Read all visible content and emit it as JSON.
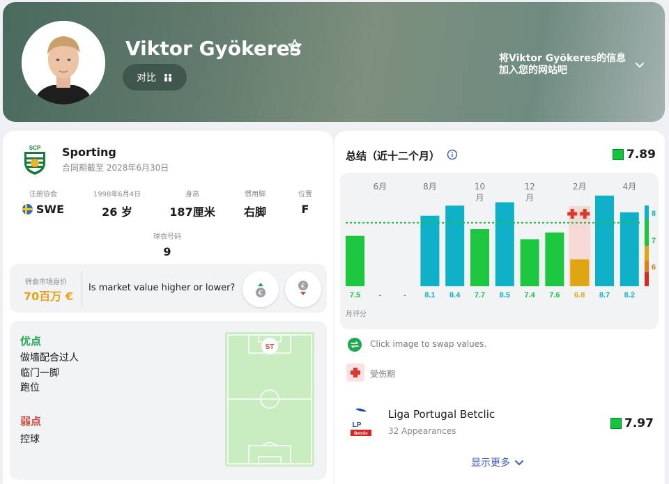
{
  "player": {
    "name": "Viktor Gyökeres",
    "compare_label": "对比",
    "embed_text": "将Viktor Gyökeres的信息加入您的网站吧"
  },
  "club": {
    "name": "Sporting",
    "logo_text": "SCP",
    "contract": "合同期截至 2028年6月30日"
  },
  "info": [
    {
      "label": "注册协会",
      "value": "SWE"
    },
    {
      "label": "1998年6月4日",
      "value": "26 岁"
    },
    {
      "label": "身高",
      "value": "187厘米"
    },
    {
      "label": "惯用脚",
      "value": "右脚"
    },
    {
      "label": "位置",
      "value": "F"
    }
  ],
  "shirt": {
    "label": "球衣号码",
    "value": "9"
  },
  "market_value": {
    "label": "转会市场身价",
    "value": "70百万 €",
    "question": "Is market value higher or lower?"
  },
  "traits": {
    "strengths_title": "优点",
    "strengths": [
      "做墙配合过人",
      "临门一脚",
      "跑位"
    ],
    "weaknesses_title": "弱点",
    "weaknesses": [
      "控球"
    ],
    "position_badge": "ST"
  },
  "summary": {
    "title": "总结（近十二个月）",
    "rating": "7.89"
  },
  "chart_data": {
    "type": "bar",
    "title": "",
    "xlabel": "",
    "ylabel": "月评分",
    "month_labels": [
      "6月",
      "8月",
      "10\n月",
      "12\n月",
      "2月",
      "4月"
    ],
    "month_label_positions": [
      1,
      3,
      5,
      7,
      9,
      11
    ],
    "values": [
      7.5,
      null,
      null,
      8.1,
      8.4,
      7.7,
      8.5,
      7.4,
      7.6,
      6.8,
      8.7,
      8.2
    ],
    "value_labels": [
      "7.5",
      "-",
      "-",
      "8.1",
      "8.4",
      "7.7",
      "8.5",
      "7.4",
      "7.6",
      "6.8",
      "8.7",
      "8.2"
    ],
    "injury_months": [
      9
    ],
    "average": 7.89,
    "ylim": [
      6,
      8.8
    ],
    "scale_ticks": [
      "8",
      "7",
      "6"
    ],
    "colors": {
      "high": "#0eb1c8",
      "mid": "#1cc73f",
      "low": "#e0a512"
    }
  },
  "legend": {
    "swap_text": "Click image to swap values.",
    "injury_text": "受伤期"
  },
  "league": {
    "name": "Liga Portugal Betclic",
    "appearances": "32 Appearances",
    "rating": "7.97",
    "logo_text": "LP",
    "logo_sub": "Betclic"
  },
  "show_more": "显示更多"
}
